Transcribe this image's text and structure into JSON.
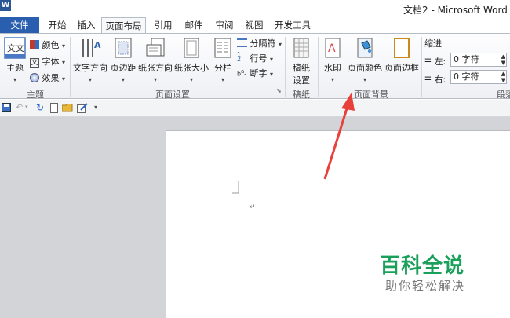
{
  "app": {
    "icon_letter": "W",
    "window_title": "文档2 - Microsoft Word"
  },
  "tabs": [
    "文件",
    "开始",
    "插入",
    "页面布局",
    "引用",
    "邮件",
    "审阅",
    "视图",
    "开发工具"
  ],
  "ribbon": {
    "theme": {
      "button": "主题",
      "colors": "颜色",
      "fonts": "字体",
      "effects": "效果",
      "group": "主题"
    },
    "page_setup": {
      "text_direction": "文字方向",
      "margins": "页边距",
      "orientation": "纸张方向",
      "size": "纸张大小",
      "columns": "分栏",
      "breaks": "分隔符",
      "line_numbers": "行号",
      "hyphenation": "断字",
      "group": "页面设置"
    },
    "draft": {
      "button_line1": "稿纸",
      "button_line2": "设置",
      "group": "稿纸"
    },
    "page_background": {
      "watermark": "水印",
      "page_color": "页面颜色",
      "page_borders": "页面边框",
      "group": "页面背景"
    },
    "paragraph": {
      "indent": "缩进",
      "left_label": "左:",
      "left_value": "0 字符",
      "right_label": "右:",
      "right_value": "0 字符",
      "group": "段落"
    }
  },
  "watermark_brand": {
    "title": "百科全说",
    "subtitle": "助你轻松解决"
  },
  "colors": {
    "file_tab": "#2a5fb0",
    "arrow": "#e8413c",
    "brand": "#1aa05a"
  }
}
